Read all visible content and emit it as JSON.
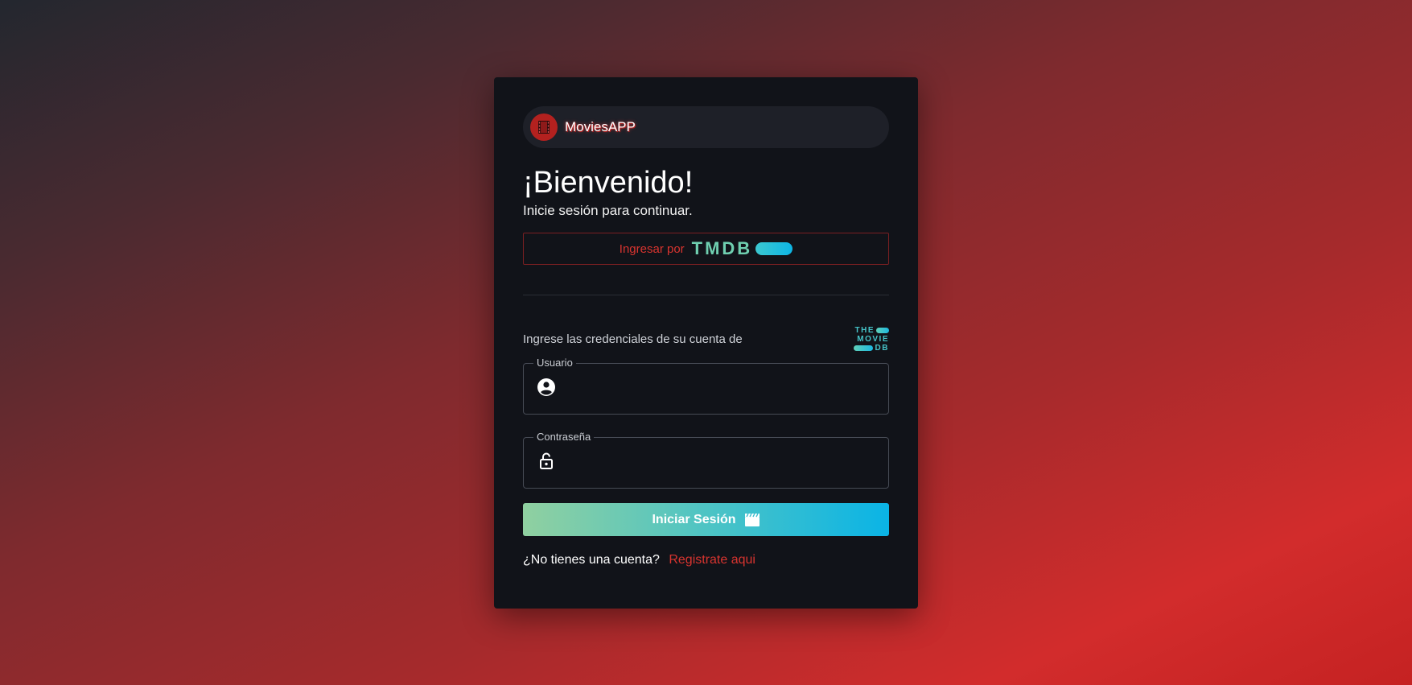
{
  "brand": {
    "name": "MoviesAPP",
    "logo_icon": "film-reel-icon",
    "accent": "#b3211f"
  },
  "welcome": {
    "title": "¡Bienvenido!",
    "subtitle": "Inicie sesión para continuar."
  },
  "tmdb_login": {
    "label": "Ingresar por",
    "logo_text": "TMDB"
  },
  "credentials": {
    "prompt": "Ingrese las credenciales de su cuenta de",
    "logo_lines": [
      "THE",
      "MOVIE",
      "DB"
    ]
  },
  "form": {
    "username": {
      "label": "Usuario",
      "value": "",
      "icon": "account-circle-icon"
    },
    "password": {
      "label": "Contraseña",
      "value": "",
      "icon": "lock-open-icon"
    },
    "submit_label": "Iniciar Sesión",
    "submit_icon": "clapperboard-icon"
  },
  "register": {
    "question": "¿No tienes una cuenta?",
    "link": "Registrate aqui"
  },
  "colors": {
    "card_bg": "#111319",
    "link_red": "#d8342f",
    "button_gradient_start": "#90d0a0",
    "button_gradient_end": "#0ab4e6"
  }
}
